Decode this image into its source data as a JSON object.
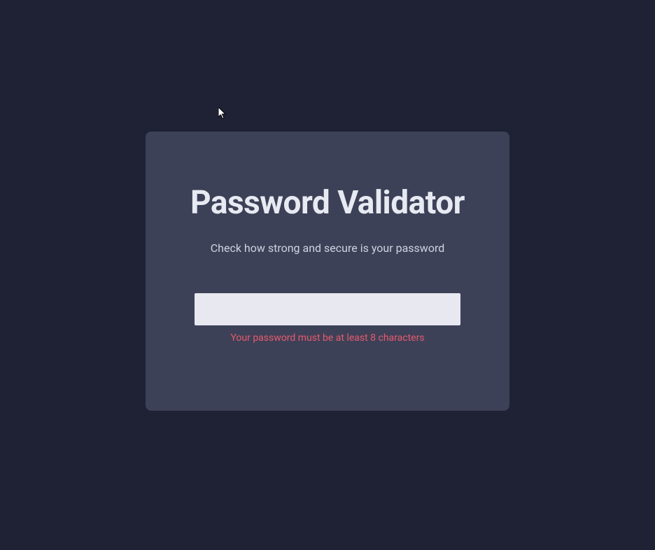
{
  "card": {
    "title": "Password Validator",
    "subtitle": "Check how strong and secure is your password",
    "input_value": "",
    "error_message": "Your password must be at least 8 characters"
  }
}
